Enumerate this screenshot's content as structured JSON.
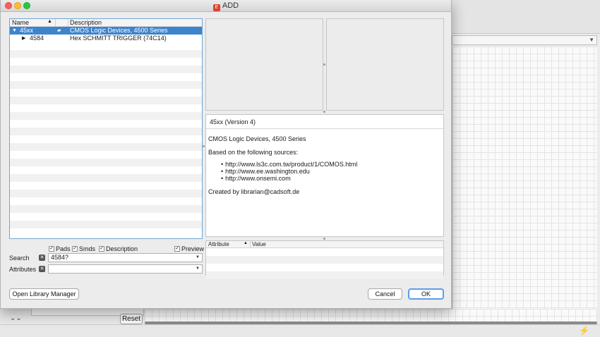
{
  "window": {
    "title": "ADD",
    "title_icon": "eagle-app-icon"
  },
  "tree": {
    "columns": {
      "name": "Name",
      "description": "Description"
    },
    "rows": [
      {
        "name": "45xx",
        "description": "CMOS Logic Devices, 4500 Series",
        "expanded": true,
        "selected": true
      },
      {
        "name": "4584",
        "description": "Hex SCHMITT TRIGGER (74C14)",
        "expanded": false,
        "selected": false
      }
    ]
  },
  "description": {
    "title": "45xx (Version 4)",
    "summary": "CMOS Logic Devices, 4500 Series",
    "sources_label": "Based on the following sources:",
    "sources": [
      "http://www.ls3c.com.tw/product/1/COMOS.html",
      "http://www.ee.washington.edu",
      "http://www.onsemi.com"
    ],
    "created_by": "Created by librarian@cadsoft.de"
  },
  "attributes_table": {
    "col_attribute": "Attribute",
    "col_value": "Value"
  },
  "options": {
    "pads": "Pads",
    "smds": "Smds",
    "description": "Description",
    "preview": "Preview"
  },
  "search": {
    "label": "Search",
    "value": "4584?"
  },
  "attributes": {
    "label": "Attributes",
    "value": ""
  },
  "buttons": {
    "open_library_manager": "Open Library Manager",
    "cancel": "Cancel",
    "ok": "OK"
  },
  "background": {
    "reset": "Reset"
  },
  "colors": {
    "selection": "#3d84cc",
    "focus": "#5b9ee6"
  }
}
